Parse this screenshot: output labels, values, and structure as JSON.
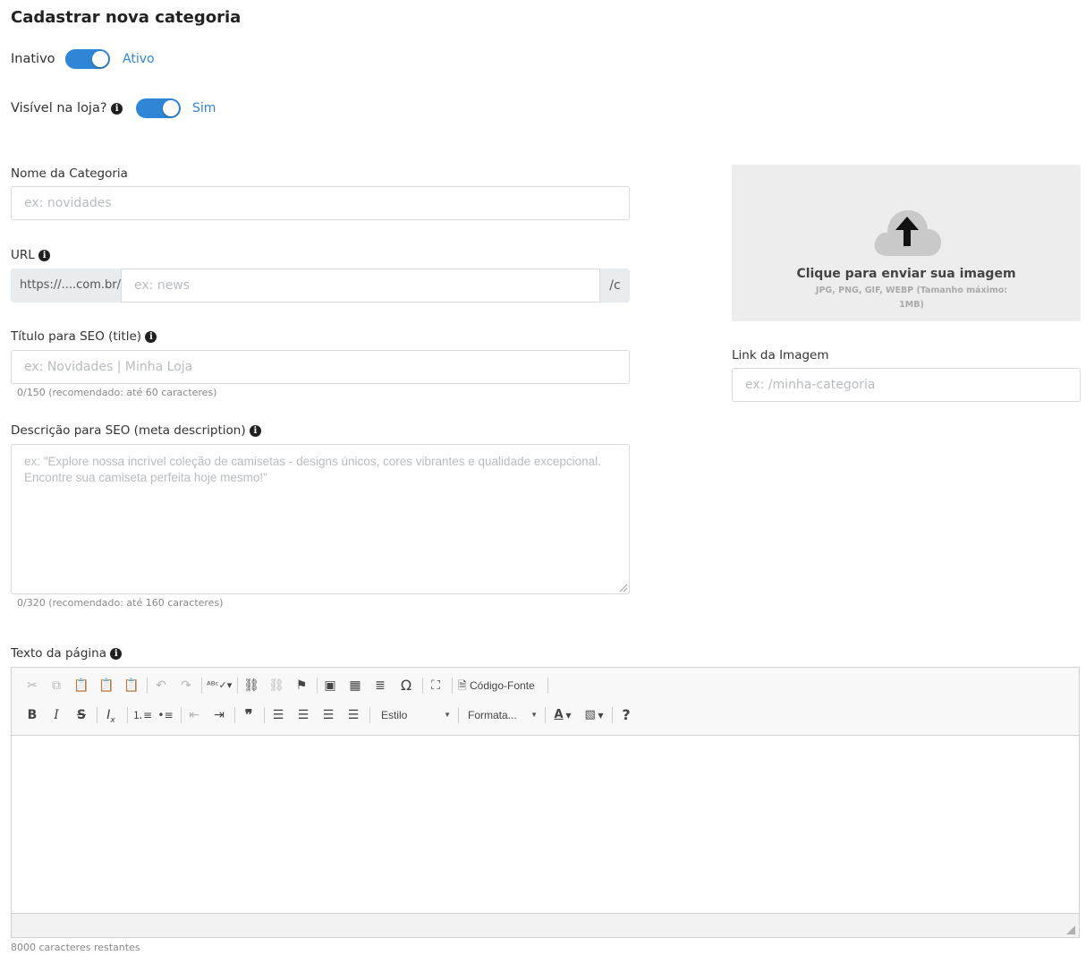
{
  "page": {
    "title": "Cadastrar nova categoria"
  },
  "status_toggle": {
    "off_label": "Inativo",
    "on_label": "Ativo",
    "on": true
  },
  "visible_toggle": {
    "label": "Visível na loja?",
    "on_label": "Sim",
    "on": true
  },
  "name_field": {
    "label": "Nome da Categoria",
    "placeholder": "ex: novidades"
  },
  "url_field": {
    "label": "URL",
    "prefix": "https://....com.br/",
    "placeholder": "ex: news",
    "suffix": "/c"
  },
  "seo_title": {
    "label": "Título para SEO (title)",
    "placeholder": "ex: Novidades | Minha Loja",
    "counter": "0/150 (recomendado: até 60 caracteres)"
  },
  "seo_desc": {
    "label": "Descrição para SEO (meta description)",
    "placeholder": "ex: \"Explore nossa incrível coleção de camisetas - designs únicos, cores vibrantes e qualidade excepcional. Encontre sua camiseta perfeita hoje mesmo!\"",
    "counter": "0/320 (recomendado: até 160 caracteres)"
  },
  "upload": {
    "title": "Clique para enviar sua imagem",
    "hint_line1": "JPG, PNG, GIF, WEBP (Tamanho máximo:",
    "hint_line2": "1MB)",
    "icon": "cloud-upload-icon"
  },
  "image_link": {
    "label": "Link da Imagem",
    "placeholder": "ex: /minha-categoria"
  },
  "page_text": {
    "label": "Texto da página",
    "remaining": "8000 caracteres restantes"
  },
  "editor": {
    "source_label": "Código-Fonte",
    "style_combo": "Estilo",
    "format_combo": "Formata...",
    "help": "?"
  }
}
